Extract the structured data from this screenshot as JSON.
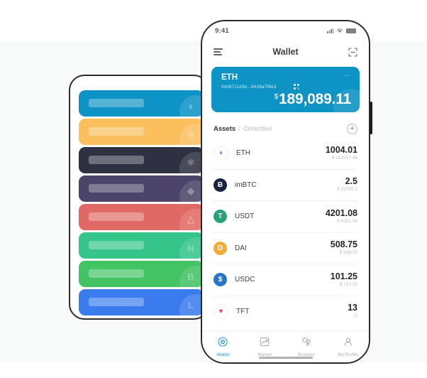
{
  "background": {
    "panel_color": "#f8f9f9"
  },
  "card_deck": {
    "name": "placeholder-token-cards",
    "cards": [
      {
        "color": "#0e93c6",
        "mark": "♦"
      },
      {
        "color": "#fac05e",
        "mark": "B"
      },
      {
        "color": "#2f3142",
        "mark": "⚛"
      },
      {
        "color": "#4b4468",
        "mark": "◆"
      },
      {
        "color": "#e06a63",
        "mark": "△"
      },
      {
        "color": "#35c48a",
        "mark": "N"
      },
      {
        "color": "#42c364",
        "mark": "B"
      },
      {
        "color": "#3b7ced",
        "mark": "L"
      }
    ]
  },
  "phone": {
    "status_bar": {
      "time": "9:41",
      "signal_icon": "signal-bars-icon",
      "wifi_icon": "wifi-icon",
      "battery_icon": "battery-icon"
    },
    "nav": {
      "menu_icon": "hamburger-menu-icon",
      "title": "Wallet",
      "scan_icon": "scan-qr-icon"
    },
    "balance_card": {
      "symbol": "ETH",
      "address": "0x08711d3b...8418a7f8e3",
      "copy_icon": "qr-copy-icon",
      "more_icon": "more-options-icon",
      "currency": "$",
      "balance": "189,089.11",
      "background_color": "#0d93c4"
    },
    "assets_toolbar": {
      "tab_assets": "Assets",
      "separator": "/",
      "tab_collectibles": "Collectles",
      "add_icon": "add-asset-icon"
    },
    "assets": [
      {
        "name": "ETH",
        "amount": "1004.01",
        "fiat": "$ 162517.48",
        "icon_bg": "#ffffff",
        "icon_fg": "#8b8fd6",
        "glyph": "♦"
      },
      {
        "name": "imBTC",
        "amount": "2.5",
        "fiat": "$ 21760.1",
        "icon_bg": "#1b2142",
        "icon_fg": "#ffffff",
        "glyph": "Ƀ"
      },
      {
        "name": "USDT",
        "amount": "4201.08",
        "fiat": "$ 4201.08",
        "icon_bg": "#26a17b",
        "icon_fg": "#ffffff",
        "glyph": "T"
      },
      {
        "name": "DAI",
        "amount": "508.75",
        "fiat": "$ 508.75",
        "icon_bg": "#f5ac37",
        "icon_fg": "#ffffff",
        "glyph": "D"
      },
      {
        "name": "USDC",
        "amount": "101.25",
        "fiat": "$ 101.25",
        "icon_bg": "#2775ca",
        "icon_fg": "#ffffff",
        "glyph": "$"
      },
      {
        "name": "TFT",
        "amount": "13",
        "fiat": "0",
        "icon_bg": "#ffffff",
        "icon_fg": "#f0465c",
        "glyph": "♥"
      }
    ],
    "tab_bar": {
      "items": [
        {
          "label": "Wallet",
          "icon": "wallet-icon",
          "active": true
        },
        {
          "label": "Market",
          "icon": "market-icon",
          "active": false
        },
        {
          "label": "Browser",
          "icon": "browser-icon",
          "active": false
        },
        {
          "label": "My Profile",
          "icon": "profile-icon",
          "active": false
        }
      ],
      "active_color": "#2196d8"
    }
  }
}
